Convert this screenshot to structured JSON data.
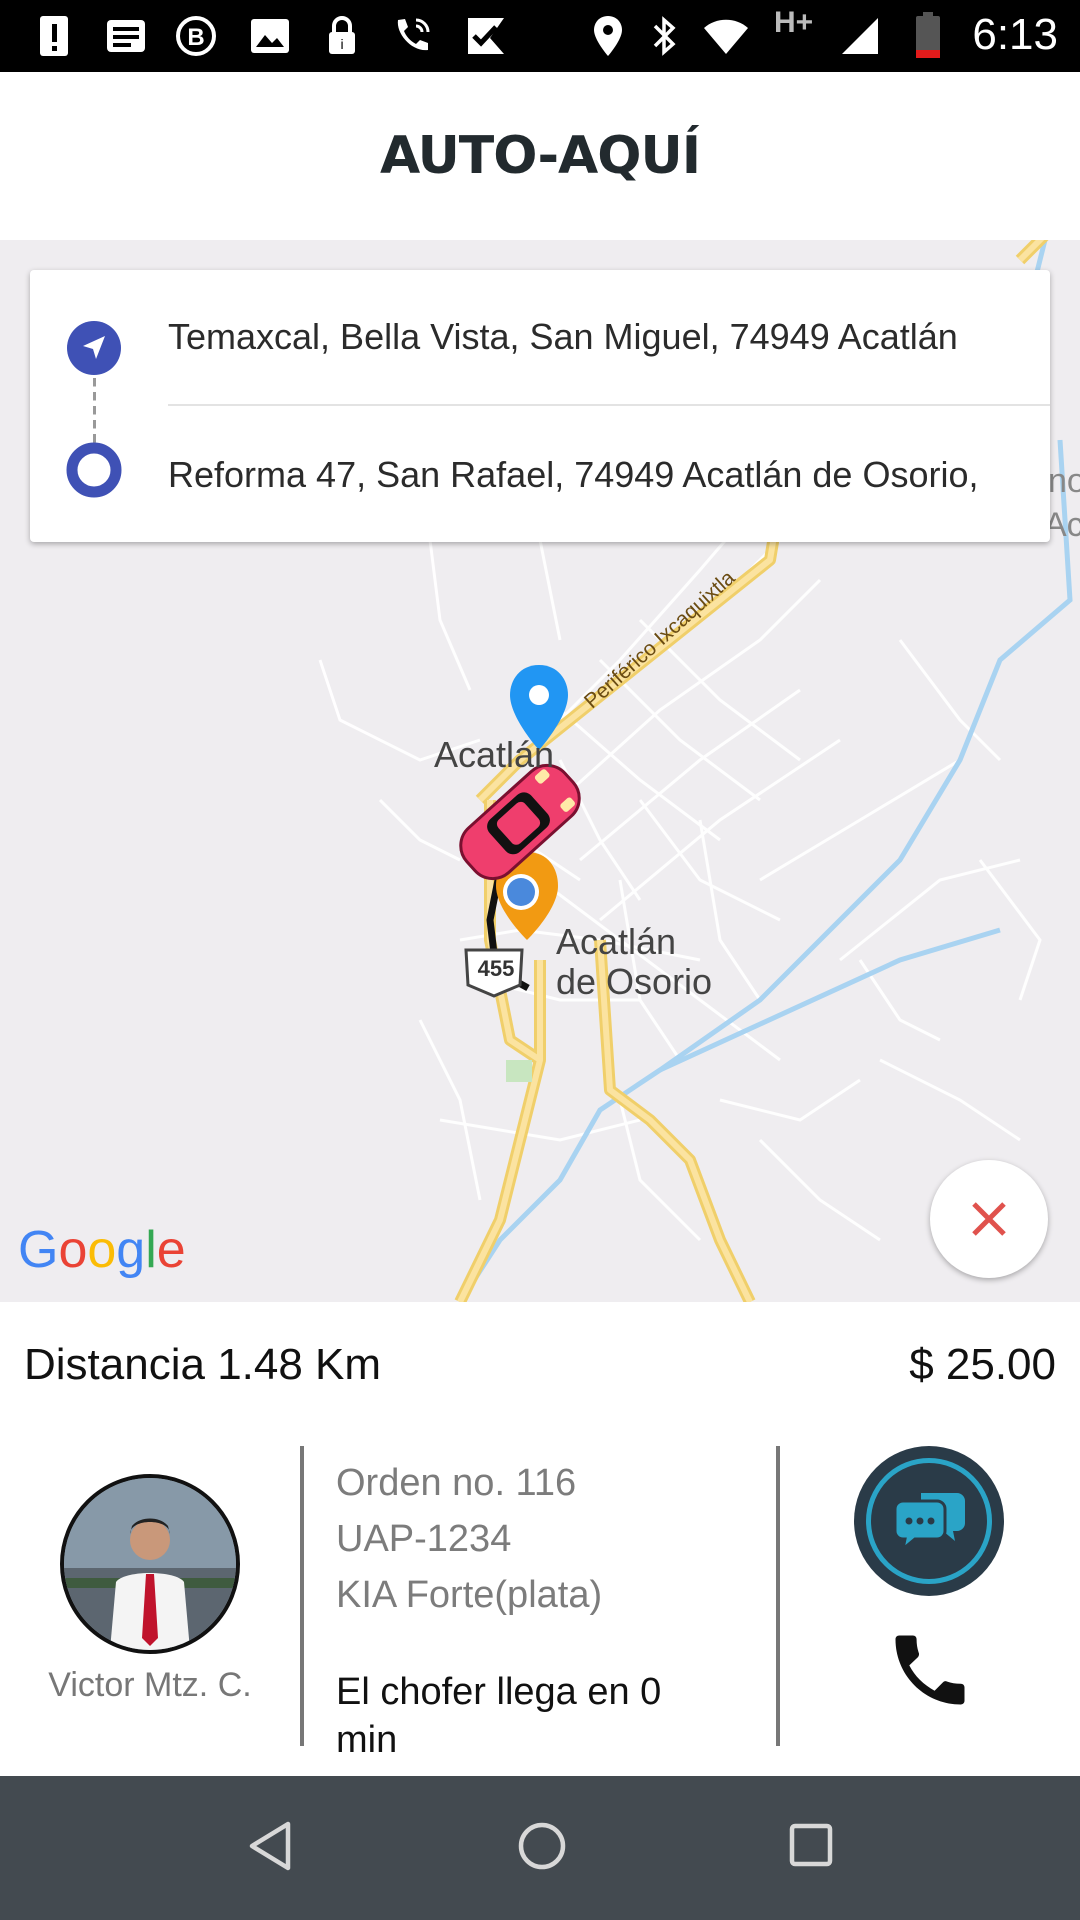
{
  "status_bar": {
    "time": "6:13",
    "network": "H+",
    "icons": [
      "alert-icon",
      "news-icon",
      "b-icon",
      "image-icon",
      "lock-icon",
      "wifi-call-icon",
      "check-icon",
      "location-icon",
      "bluetooth-icon",
      "wifi-icon",
      "signal-icon",
      "battery-icon"
    ]
  },
  "app_bar": {
    "title": "AUTO-AQUÍ"
  },
  "route": {
    "origin": "Temaxcal, Bella Vista, San Miguel, 74949 Acatlán",
    "destination": "Reforma 47, San Rafael, 74949 Acatlán de Osorio,"
  },
  "map": {
    "labels": {
      "town": "Acatlán",
      "city_line1": "Acatlán",
      "city_line2": "de Osorio",
      "road": "Periférico Ixcaquixtla",
      "highway": "455",
      "edge_1": "no",
      "edge_2": "Ac"
    },
    "logo": "Google",
    "colors": {
      "road": "#f7d97c",
      "river": "#a9d3f1",
      "background": "#efedf0"
    }
  },
  "trip": {
    "distance": "Distancia 1.48 Km",
    "price": "$ 25.00"
  },
  "driver": {
    "name": "Victor Mtz. C.",
    "order": "Orden no. 116",
    "plate": "UAP-1234",
    "car": "KIA Forte(plata)",
    "eta": "El chofer llega en 0 min"
  },
  "colors": {
    "accent": "#3f51b5",
    "close": "#e0524d",
    "chat_bg": "#2a3b48",
    "chat_ring": "#2aa4c7"
  },
  "nav": {
    "icons": [
      "back-icon",
      "home-icon",
      "recents-icon"
    ]
  }
}
